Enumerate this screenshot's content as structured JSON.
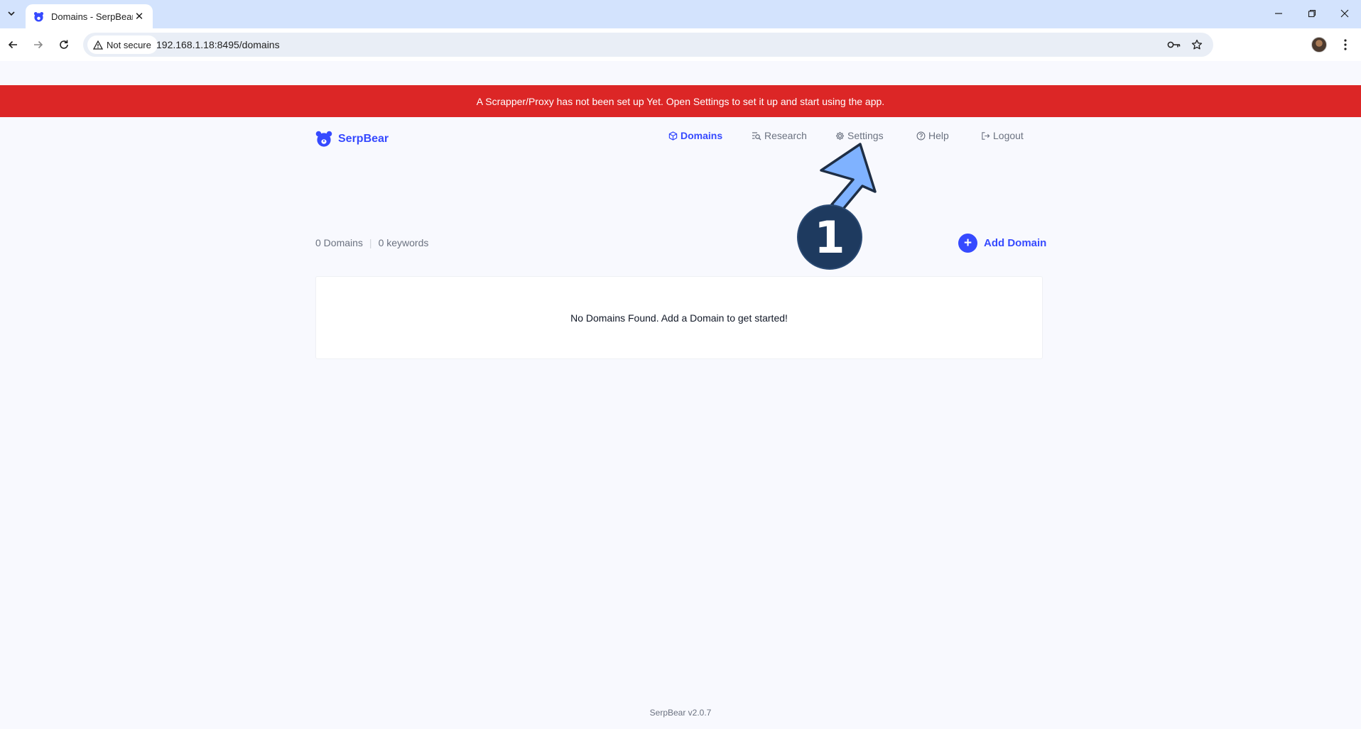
{
  "browser": {
    "tab_title": "Domains - SerpBear",
    "security_label": "Not secure",
    "url": "192.168.1.18:8495/domains"
  },
  "alert": {
    "text": "A Scrapper/Proxy has not been set up Yet. Open Settings to set it up and start using the app."
  },
  "app": {
    "brand": "SerpBear",
    "accent_color": "#364aff",
    "nav": [
      {
        "label": "Domains",
        "icon": "domains-icon",
        "active": true
      },
      {
        "label": "Research",
        "icon": "research-icon",
        "active": false
      },
      {
        "label": "Settings",
        "icon": "gear-icon",
        "active": false
      },
      {
        "label": "Help",
        "icon": "help-icon",
        "active": false
      },
      {
        "label": "Logout",
        "icon": "logout-icon",
        "active": false
      }
    ]
  },
  "summary": {
    "domains": "0 Domains",
    "keywords": "0 keywords"
  },
  "add_domain": {
    "label": "Add Domain"
  },
  "empty_state": {
    "text": "No Domains Found. Add a Domain to get started!"
  },
  "annotation": {
    "step": "1"
  },
  "footer": {
    "version": "SerpBear v2.0.7"
  }
}
